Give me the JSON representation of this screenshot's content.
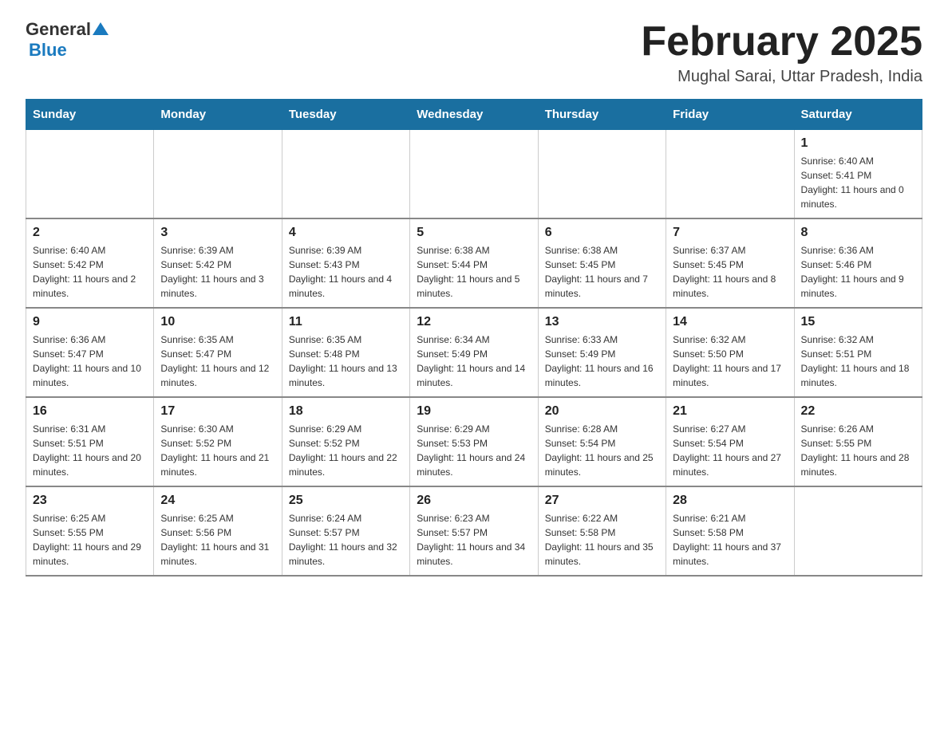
{
  "header": {
    "logo_general": "General",
    "logo_blue": "Blue",
    "month_title": "February 2025",
    "location": "Mughal Sarai, Uttar Pradesh, India"
  },
  "weekdays": [
    "Sunday",
    "Monday",
    "Tuesday",
    "Wednesday",
    "Thursday",
    "Friday",
    "Saturday"
  ],
  "weeks": [
    [
      {
        "day": "",
        "info": ""
      },
      {
        "day": "",
        "info": ""
      },
      {
        "day": "",
        "info": ""
      },
      {
        "day": "",
        "info": ""
      },
      {
        "day": "",
        "info": ""
      },
      {
        "day": "",
        "info": ""
      },
      {
        "day": "1",
        "info": "Sunrise: 6:40 AM\nSunset: 5:41 PM\nDaylight: 11 hours and 0 minutes."
      }
    ],
    [
      {
        "day": "2",
        "info": "Sunrise: 6:40 AM\nSunset: 5:42 PM\nDaylight: 11 hours and 2 minutes."
      },
      {
        "day": "3",
        "info": "Sunrise: 6:39 AM\nSunset: 5:42 PM\nDaylight: 11 hours and 3 minutes."
      },
      {
        "day": "4",
        "info": "Sunrise: 6:39 AM\nSunset: 5:43 PM\nDaylight: 11 hours and 4 minutes."
      },
      {
        "day": "5",
        "info": "Sunrise: 6:38 AM\nSunset: 5:44 PM\nDaylight: 11 hours and 5 minutes."
      },
      {
        "day": "6",
        "info": "Sunrise: 6:38 AM\nSunset: 5:45 PM\nDaylight: 11 hours and 7 minutes."
      },
      {
        "day": "7",
        "info": "Sunrise: 6:37 AM\nSunset: 5:45 PM\nDaylight: 11 hours and 8 minutes."
      },
      {
        "day": "8",
        "info": "Sunrise: 6:36 AM\nSunset: 5:46 PM\nDaylight: 11 hours and 9 minutes."
      }
    ],
    [
      {
        "day": "9",
        "info": "Sunrise: 6:36 AM\nSunset: 5:47 PM\nDaylight: 11 hours and 10 minutes."
      },
      {
        "day": "10",
        "info": "Sunrise: 6:35 AM\nSunset: 5:47 PM\nDaylight: 11 hours and 12 minutes."
      },
      {
        "day": "11",
        "info": "Sunrise: 6:35 AM\nSunset: 5:48 PM\nDaylight: 11 hours and 13 minutes."
      },
      {
        "day": "12",
        "info": "Sunrise: 6:34 AM\nSunset: 5:49 PM\nDaylight: 11 hours and 14 minutes."
      },
      {
        "day": "13",
        "info": "Sunrise: 6:33 AM\nSunset: 5:49 PM\nDaylight: 11 hours and 16 minutes."
      },
      {
        "day": "14",
        "info": "Sunrise: 6:32 AM\nSunset: 5:50 PM\nDaylight: 11 hours and 17 minutes."
      },
      {
        "day": "15",
        "info": "Sunrise: 6:32 AM\nSunset: 5:51 PM\nDaylight: 11 hours and 18 minutes."
      }
    ],
    [
      {
        "day": "16",
        "info": "Sunrise: 6:31 AM\nSunset: 5:51 PM\nDaylight: 11 hours and 20 minutes."
      },
      {
        "day": "17",
        "info": "Sunrise: 6:30 AM\nSunset: 5:52 PM\nDaylight: 11 hours and 21 minutes."
      },
      {
        "day": "18",
        "info": "Sunrise: 6:29 AM\nSunset: 5:52 PM\nDaylight: 11 hours and 22 minutes."
      },
      {
        "day": "19",
        "info": "Sunrise: 6:29 AM\nSunset: 5:53 PM\nDaylight: 11 hours and 24 minutes."
      },
      {
        "day": "20",
        "info": "Sunrise: 6:28 AM\nSunset: 5:54 PM\nDaylight: 11 hours and 25 minutes."
      },
      {
        "day": "21",
        "info": "Sunrise: 6:27 AM\nSunset: 5:54 PM\nDaylight: 11 hours and 27 minutes."
      },
      {
        "day": "22",
        "info": "Sunrise: 6:26 AM\nSunset: 5:55 PM\nDaylight: 11 hours and 28 minutes."
      }
    ],
    [
      {
        "day": "23",
        "info": "Sunrise: 6:25 AM\nSunset: 5:55 PM\nDaylight: 11 hours and 29 minutes."
      },
      {
        "day": "24",
        "info": "Sunrise: 6:25 AM\nSunset: 5:56 PM\nDaylight: 11 hours and 31 minutes."
      },
      {
        "day": "25",
        "info": "Sunrise: 6:24 AM\nSunset: 5:57 PM\nDaylight: 11 hours and 32 minutes."
      },
      {
        "day": "26",
        "info": "Sunrise: 6:23 AM\nSunset: 5:57 PM\nDaylight: 11 hours and 34 minutes."
      },
      {
        "day": "27",
        "info": "Sunrise: 6:22 AM\nSunset: 5:58 PM\nDaylight: 11 hours and 35 minutes."
      },
      {
        "day": "28",
        "info": "Sunrise: 6:21 AM\nSunset: 5:58 PM\nDaylight: 11 hours and 37 minutes."
      },
      {
        "day": "",
        "info": ""
      }
    ]
  ]
}
